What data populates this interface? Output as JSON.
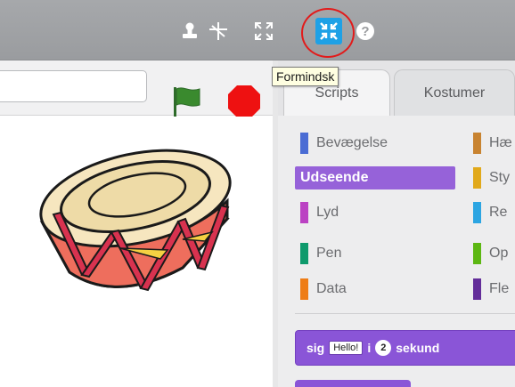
{
  "tooltip": {
    "text": "Formindsk"
  },
  "tabs": [
    {
      "label": "Scripts"
    },
    {
      "label": "Kostumer"
    }
  ],
  "categories": {
    "left": [
      {
        "label": "Bevægelse",
        "color": "#4a6cd4"
      },
      {
        "label": "Udseende",
        "color": "#8a55d7",
        "selected": true
      },
      {
        "label": "Lyd",
        "color": "#bb42c3"
      },
      {
        "label": "Pen",
        "color": "#0e9a6c"
      },
      {
        "label": "Data",
        "color": "#ee7d16"
      }
    ],
    "right": [
      {
        "label": "Hæ",
        "color": "#c88330"
      },
      {
        "label": "Sty",
        "color": "#e1a91a"
      },
      {
        "label": "Re",
        "color": "#2ca5e2"
      },
      {
        "label": "Op",
        "color": "#5cb712"
      },
      {
        "label": "Fle",
        "color": "#632d99"
      }
    ]
  },
  "block": {
    "keyword": "sig",
    "input": "Hello!",
    "joiner": "i",
    "number": "2",
    "suffix": "sekund"
  },
  "colors": {
    "accent": "#1ea1e6",
    "highlight": "#e21b1b",
    "looks": "#8a55d7"
  },
  "icons": [
    "stamp-icon",
    "cut-icon",
    "grow-icon",
    "shrink-icon",
    "help-icon",
    "green-flag-icon",
    "stop-icon",
    "drum-sprite"
  ]
}
